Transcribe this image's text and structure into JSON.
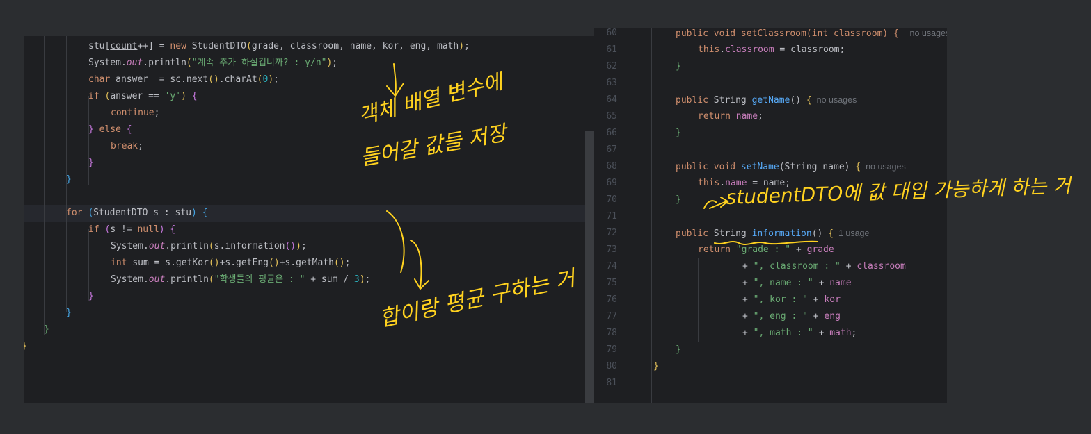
{
  "left_code": [
    {
      "parts": [
        [
          "stu[",
          "t"
        ],
        [
          "count",
          "ul"
        ],
        [
          "++] = ",
          "t"
        ],
        [
          "new ",
          "kw"
        ],
        [
          "StudentDTO",
          "t"
        ],
        [
          "(",
          "p1"
        ],
        [
          "grade, classroom, name, kor, eng, math",
          "t"
        ],
        [
          ")",
          "p1"
        ],
        [
          ";",
          "t"
        ]
      ]
    },
    {
      "parts": [
        [
          "System.",
          "t"
        ],
        [
          "out",
          "sfld"
        ],
        [
          ".println",
          "t"
        ],
        [
          "(",
          "p1"
        ],
        [
          "\"계속 추가 하실겁니까? : y/n\"",
          "str"
        ],
        [
          ")",
          "p1"
        ],
        [
          ";",
          "t"
        ]
      ]
    },
    {
      "parts": [
        [
          "char ",
          "kw"
        ],
        [
          "answer  = sc.next",
          "t"
        ],
        [
          "()",
          "p1"
        ],
        [
          ".charAt",
          "t"
        ],
        [
          "(",
          "p1"
        ],
        [
          "0",
          "num"
        ],
        [
          ")",
          "p1"
        ],
        [
          ";",
          "t"
        ]
      ]
    },
    {
      "parts": [
        [
          "if ",
          "kw"
        ],
        [
          "(",
          "p1"
        ],
        [
          "answer == ",
          "t"
        ],
        [
          "'y'",
          "str"
        ],
        [
          ")",
          "p1"
        ],
        [
          " {",
          "p2"
        ]
      ]
    },
    {
      "parts": [
        [
          "continue",
          "kw"
        ],
        [
          ";",
          "t"
        ]
      ]
    },
    {
      "parts": [
        [
          "} ",
          "p2"
        ],
        [
          "else ",
          "kw"
        ],
        [
          "{",
          "p2"
        ]
      ]
    },
    {
      "parts": [
        [
          "break",
          "kw"
        ],
        [
          ";",
          "t"
        ]
      ]
    },
    {
      "parts": [
        [
          "}",
          "p2"
        ]
      ]
    },
    {
      "parts": [
        [
          "}",
          "p3"
        ]
      ]
    },
    {
      "parts": [
        [
          "",
          "t"
        ]
      ]
    },
    {
      "parts": [
        [
          "for ",
          "kw"
        ],
        [
          "(",
          "p3"
        ],
        [
          "StudentDTO s : stu",
          "t"
        ],
        [
          ")",
          "p3"
        ],
        [
          " {",
          "p3"
        ]
      ]
    },
    {
      "parts": [
        [
          "if ",
          "kw"
        ],
        [
          "(",
          "p2"
        ],
        [
          "s != ",
          "t"
        ],
        [
          "null",
          "kw"
        ],
        [
          ")",
          "p2"
        ],
        [
          " {",
          "p2"
        ]
      ]
    },
    {
      "parts": [
        [
          "System.",
          "t"
        ],
        [
          "out",
          "sfld"
        ],
        [
          ".println",
          "t"
        ],
        [
          "(",
          "p1"
        ],
        [
          "s.information",
          "t"
        ],
        [
          "()",
          "p2"
        ],
        [
          ")",
          "p1"
        ],
        [
          ";",
          "t"
        ]
      ]
    },
    {
      "parts": [
        [
          "int ",
          "kw"
        ],
        [
          "sum = s.getKor",
          "t"
        ],
        [
          "()",
          "p1"
        ],
        [
          "+s.getEng",
          "t"
        ],
        [
          "()",
          "p1"
        ],
        [
          "+s.getMath",
          "t"
        ],
        [
          "()",
          "p1"
        ],
        [
          ";",
          "t"
        ]
      ]
    },
    {
      "parts": [
        [
          "System.",
          "t"
        ],
        [
          "out",
          "sfld"
        ],
        [
          ".println",
          "t"
        ],
        [
          "(",
          "p1"
        ],
        [
          "\"학생들의 평균은 : \"",
          "str"
        ],
        [
          " + sum / ",
          "t"
        ],
        [
          "3",
          "num"
        ],
        [
          ")",
          "p1"
        ],
        [
          ";",
          "t"
        ]
      ]
    },
    {
      "parts": [
        [
          "}",
          "p2"
        ]
      ]
    },
    {
      "parts": [
        [
          "}",
          "p3"
        ]
      ]
    },
    {
      "parts": [
        [
          "}",
          "str"
        ]
      ]
    },
    {
      "parts": [
        [
          "}",
          "p1"
        ]
      ]
    }
  ],
  "right_code": [
    {
      "num": "60",
      "parts": [
        [
          "public void setClassroom(int classroom) {  ",
          "kw"
        ],
        [
          "no usages",
          "hint"
        ]
      ]
    },
    {
      "num": "61",
      "parts": [
        [
          "this",
          "kw"
        ],
        [
          ".",
          "t"
        ],
        [
          "classroom",
          "fld"
        ],
        [
          " = classroom;",
          "t"
        ]
      ]
    },
    {
      "num": "62",
      "parts": [
        [
          "}",
          "str"
        ]
      ]
    },
    {
      "num": "63",
      "parts": [
        [
          "",
          "t"
        ]
      ]
    },
    {
      "num": "64",
      "parts": [
        [
          "public ",
          "kw"
        ],
        [
          "String ",
          "t"
        ],
        [
          "getName",
          "meth"
        ],
        [
          "() ",
          "t"
        ],
        [
          "{",
          "p1"
        ],
        [
          "  no usages",
          "hint"
        ]
      ]
    },
    {
      "num": "65",
      "parts": [
        [
          "return ",
          "kw"
        ],
        [
          "name",
          "fld"
        ],
        [
          ";",
          "t"
        ]
      ]
    },
    {
      "num": "66",
      "parts": [
        [
          "}",
          "str"
        ]
      ]
    },
    {
      "num": "67",
      "parts": [
        [
          "",
          "t"
        ]
      ]
    },
    {
      "num": "68",
      "parts": [
        [
          "public void ",
          "kw"
        ],
        [
          "setName",
          "meth"
        ],
        [
          "(",
          "t"
        ],
        [
          "String name",
          "t"
        ],
        [
          ") ",
          "t"
        ],
        [
          "{",
          "p1"
        ],
        [
          "  no usages",
          "hint"
        ]
      ]
    },
    {
      "num": "69",
      "parts": [
        [
          "this",
          "kw"
        ],
        [
          ".",
          "t"
        ],
        [
          "name",
          "fld"
        ],
        [
          " = name;",
          "t"
        ]
      ]
    },
    {
      "num": "70",
      "parts": [
        [
          "}",
          "str"
        ]
      ]
    },
    {
      "num": "71",
      "parts": [
        [
          "",
          "t"
        ]
      ]
    },
    {
      "num": "72",
      "parts": [
        [
          "public ",
          "kw"
        ],
        [
          "String ",
          "t"
        ],
        [
          "information",
          "meth"
        ],
        [
          "() ",
          "t"
        ],
        [
          "{",
          "p1"
        ],
        [
          "  1 usage",
          "hint"
        ]
      ]
    },
    {
      "num": "73",
      "parts": [
        [
          "return ",
          "kw"
        ],
        [
          "\"grade : \"",
          "str"
        ],
        [
          " + ",
          "t"
        ],
        [
          "grade",
          "fld"
        ]
      ]
    },
    {
      "num": "74",
      "parts": [
        [
          "+ ",
          "t"
        ],
        [
          "\", classroom : \"",
          "str"
        ],
        [
          " + ",
          "t"
        ],
        [
          "classroom",
          "fld"
        ]
      ]
    },
    {
      "num": "75",
      "parts": [
        [
          "+ ",
          "t"
        ],
        [
          "\", name : \"",
          "str"
        ],
        [
          " + ",
          "t"
        ],
        [
          "name",
          "fld"
        ]
      ]
    },
    {
      "num": "76",
      "parts": [
        [
          "+ ",
          "t"
        ],
        [
          "\", kor : \"",
          "str"
        ],
        [
          " + ",
          "t"
        ],
        [
          "kor",
          "fld"
        ]
      ]
    },
    {
      "num": "77",
      "parts": [
        [
          "+ ",
          "t"
        ],
        [
          "\", eng : \"",
          "str"
        ],
        [
          " + ",
          "t"
        ],
        [
          "eng",
          "fld"
        ]
      ]
    },
    {
      "num": "78",
      "parts": [
        [
          "+ ",
          "t"
        ],
        [
          "\", math : \"",
          "str"
        ],
        [
          " + ",
          "t"
        ],
        [
          "math",
          "fld"
        ],
        [
          ";",
          "t"
        ]
      ]
    },
    {
      "num": "79",
      "parts": [
        [
          "}",
          "str"
        ]
      ]
    },
    {
      "num": "80",
      "parts": [
        [
          "}",
          "p1"
        ]
      ]
    },
    {
      "num": "81",
      "parts": [
        [
          "",
          "t"
        ]
      ]
    }
  ],
  "annotations": {
    "note_object_array": "객체 배열 변수에",
    "note_values_store": "들어갈 값들 저장",
    "note_sum_avg": "합이랑 평균 구하는 거",
    "note_studentdto": "studentDTO에 값 대입 가능하게 하는 거"
  },
  "colors": {
    "editor_bg": "#1e1f22",
    "handwriting": "#ffd21f"
  }
}
